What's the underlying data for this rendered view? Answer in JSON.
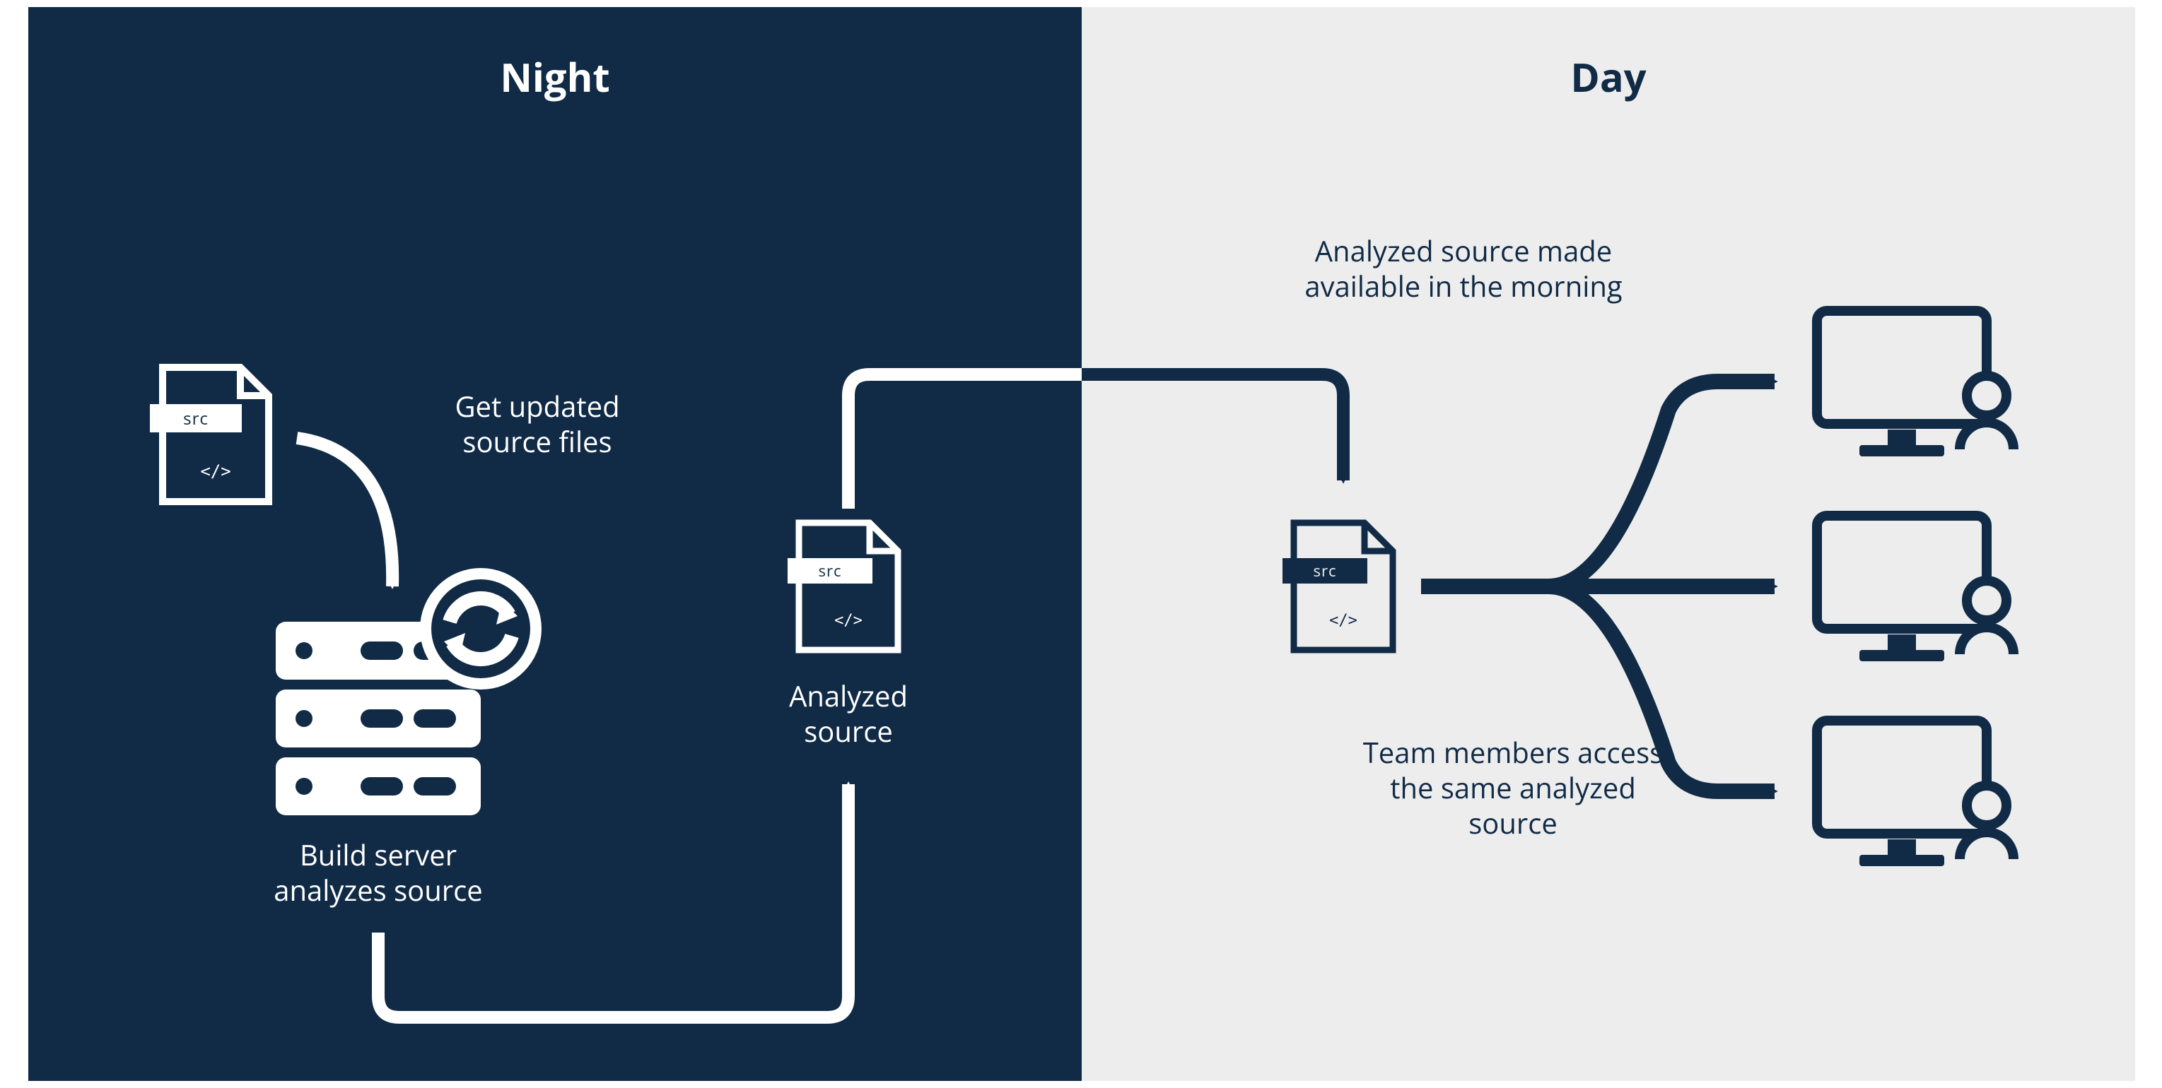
{
  "colors": {
    "navy": "#112b46",
    "light": "#ededee",
    "white": "#ffffff"
  },
  "left": {
    "title": "Night",
    "src_tag": "src",
    "code_glyph": "</>",
    "label_get_updated_1": "Get updated",
    "label_get_updated_2": "source files",
    "label_build_server_1": "Build server",
    "label_build_server_2": "analyzes source",
    "label_analyzed_1": "Analyzed",
    "label_analyzed_2": "source"
  },
  "right": {
    "title": "Day",
    "src_tag": "src",
    "code_glyph": "</>",
    "label_morning_1": "Analyzed source made",
    "label_morning_2": "available in the morning",
    "label_team_1": "Team members access",
    "label_team_2": "the same analyzed",
    "label_team_3": "source"
  }
}
